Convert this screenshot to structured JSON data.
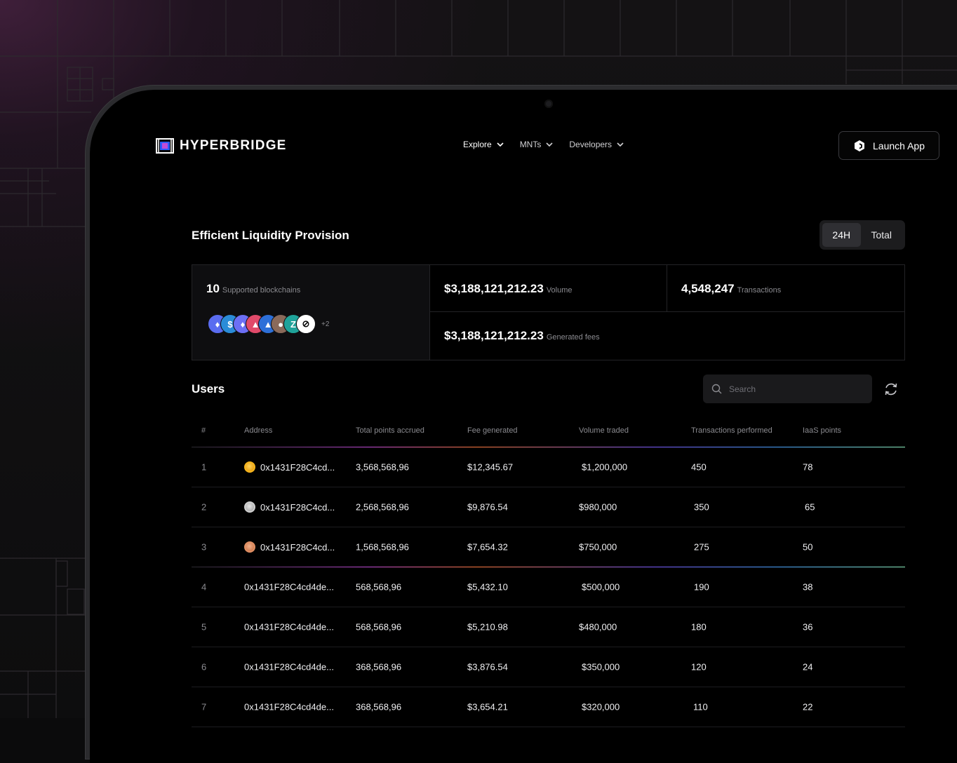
{
  "header": {
    "brand": "HYPERBRIDGE",
    "nav": [
      {
        "label": "Explore"
      },
      {
        "label": "MNTs"
      },
      {
        "label": "Developers"
      }
    ],
    "launch_label": "Launch App"
  },
  "liquidity": {
    "title": "Efficient Liquidity Provision",
    "toggle": {
      "active": "24H",
      "inactive": "Total"
    },
    "chains_count": "10",
    "chains_label": "Supported blockchains",
    "chains_more": "+2",
    "chain_icons": [
      "ethereum-icon",
      "usdc-icon",
      "ethereum-icon",
      "arbitrum-icon",
      "avalanche-icon",
      "polkadot-icon",
      "zksync-icon",
      "unichain-icon"
    ],
    "volume_value": "$3,188,121,212.23",
    "volume_label": "Volume",
    "tx_value": "4,548,247",
    "tx_label": "Transactions",
    "fees_value": "$3,188,121,212.23",
    "fees_label": "Generated fees"
  },
  "users": {
    "title": "Users",
    "search_placeholder": "Search",
    "columns": [
      "#",
      "Address",
      "Total points accrued",
      "Fee generated",
      "Volume traded",
      "Transactions performed",
      "IaaS points"
    ],
    "rows": [
      {
        "num": "1",
        "address": "0x1431F28C4cd...",
        "medal": "gold",
        "points": "3,568,568,96",
        "fee": "$12,345.67",
        "volume": "$1,200,000",
        "tx": "450",
        "iaas": "78"
      },
      {
        "num": "2",
        "address": "0x1431F28C4cd...",
        "medal": "silver",
        "points": "2,568,568,96",
        "fee": "$9,876.54",
        "volume": "$980,000",
        "tx": "350",
        "iaas": "65"
      },
      {
        "num": "3",
        "address": "0x1431F28C4cd...",
        "medal": "bronze",
        "points": "1,568,568,96",
        "fee": "$7,654.32",
        "volume": "$750,000",
        "tx": "275",
        "iaas": "50"
      },
      {
        "num": "4",
        "address": "0x1431F28C4cd4de...",
        "medal": "",
        "points": "568,568,96",
        "fee": "$5,432.10",
        "volume": "$500,000",
        "tx": "190",
        "iaas": "38"
      },
      {
        "num": "5",
        "address": "0x1431F28C4cd4de...",
        "medal": "",
        "points": "568,568,96",
        "fee": "$5,210.98",
        "volume": "$480,000",
        "tx": "180",
        "iaas": "36"
      },
      {
        "num": "6",
        "address": "0x1431F28C4cd4de...",
        "medal": "",
        "points": "368,568,96",
        "fee": "$3,876.54",
        "volume": "$350,000",
        "tx": "120",
        "iaas": "24"
      },
      {
        "num": "7",
        "address": "0x1431F28C4cd4de...",
        "medal": "",
        "points": "368,568,96",
        "fee": "$3,654.21",
        "volume": "$320,000",
        "tx": "110",
        "iaas": "22"
      }
    ]
  },
  "colors": {
    "accent_gradient": [
      "#c04bd8",
      "#ff7a3d",
      "#7a5cff",
      "#4aa3ff",
      "#8ef0c0"
    ],
    "gold": "#f6b51c",
    "silver": "#cfcfcf",
    "bronze": "#e08f63"
  }
}
